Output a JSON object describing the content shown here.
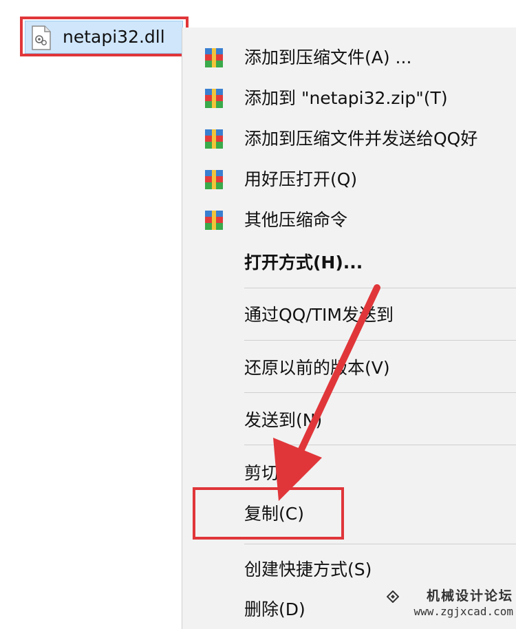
{
  "file": {
    "name": "netapi32.dll",
    "icon": "dll-file-icon"
  },
  "menu": {
    "items": [
      {
        "label": "添加到压缩文件(A) ...",
        "icon": "archive-icon"
      },
      {
        "label": "添加到 \"netapi32.zip\"(T)",
        "icon": "archive-icon"
      },
      {
        "label": "添加到压缩文件并发送给QQ好",
        "icon": "archive-icon"
      },
      {
        "label": "用好压打开(Q)",
        "icon": "archive-icon"
      },
      {
        "label": "其他压缩命令",
        "icon": "archive-icon"
      },
      {
        "label": "打开方式(H)..."
      },
      {
        "label": "通过QQ/TIM发送到"
      },
      {
        "label": "还原以前的版本(V)"
      },
      {
        "label": "发送到(N)"
      },
      {
        "label": "剪切(T)"
      },
      {
        "label": "复制(C)"
      },
      {
        "label": "创建快捷方式(S)"
      },
      {
        "label": "删除(D)"
      }
    ]
  },
  "colors": {
    "highlight": "#e0363a",
    "selection": "#cfe6fb",
    "menu_bg": "#f2f2f2"
  },
  "watermark": {
    "title": "机械设计论坛",
    "url": "www.zgjxcad.com"
  }
}
